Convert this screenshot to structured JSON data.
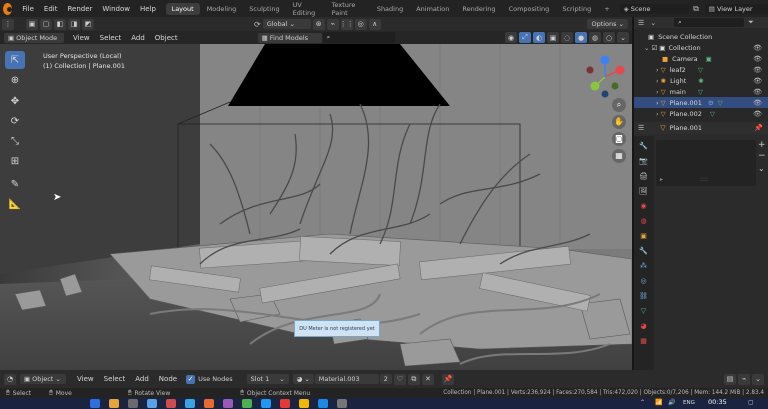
{
  "menu": {
    "items": [
      "File",
      "Edit",
      "Render",
      "Window",
      "Help"
    ]
  },
  "workspaces": {
    "tabs": [
      "Layout",
      "Modeling",
      "Sculpting",
      "UV Editing",
      "Texture Paint",
      "Shading",
      "Animation",
      "Rendering",
      "Compositing",
      "Scripting"
    ],
    "active": "Layout",
    "add_glyph": "+"
  },
  "scene": {
    "label": "Scene"
  },
  "view_layer": {
    "label": "View Layer"
  },
  "header": {
    "transform_orientation": "Global",
    "options_label": "Options",
    "mode": "Object Mode",
    "view_menu": [
      "View",
      "Select",
      "Add",
      "Object"
    ],
    "find_models_label": "Find Models"
  },
  "viewport": {
    "perspective": "User Perspective (Local)",
    "collection": "(1) Collection | Plane.001",
    "tooltip": "DU Meter is not registered yet",
    "gizmo_colors": {
      "x": "#e5484d",
      "y": "#8cc63f",
      "z": "#3b82f6"
    }
  },
  "outliner": {
    "root": "Scene Collection",
    "collection": "Collection",
    "items": [
      {
        "name": "Camera",
        "icon": "camera-icon",
        "selected": false
      },
      {
        "name": "leaf2",
        "icon": "mesh-icon",
        "selected": false
      },
      {
        "name": "Light",
        "icon": "light-icon",
        "selected": false
      },
      {
        "name": "main",
        "icon": "mesh-icon",
        "selected": false
      },
      {
        "name": "Plane.001",
        "icon": "mesh-icon",
        "selected": true
      },
      {
        "name": "Plane.002",
        "icon": "mesh-icon",
        "selected": false
      }
    ]
  },
  "properties": {
    "object_name": "Plane.001",
    "list_grip": "::::"
  },
  "shader_editor": {
    "mode": "Object",
    "menus": [
      "View",
      "Select",
      "Add",
      "Node"
    ],
    "use_nodes_label": "Use Nodes",
    "slot": "Slot 1",
    "material": "Material.003",
    "user_count": "2"
  },
  "status": {
    "left_items": [
      "Select",
      "Move",
      "Rotate View",
      "Object Context Menu"
    ],
    "stats": "Collection | Plane.001 | Verts:236,924 | Faces:270,584 | Tris:472,020 | Objects:0/7,206 | Mem: 144.2 MiB | 2.83.4"
  },
  "taskbar": {
    "time": "00:35",
    "lang": "ENG",
    "app_colors": [
      "#2f6fdb",
      "#e8a33d",
      "#6b6b6b",
      "#5aa0e6",
      "#d04b4b",
      "#3aa3e3",
      "#e86a2e",
      "#9b59b6",
      "#4caf50",
      "#2196f3",
      "#e53935",
      "#f2b705",
      "#1e88e5",
      "#757575"
    ]
  },
  "colors": {
    "accent": "#4772b3",
    "selection": "#334d80",
    "orange": "#e87d0d",
    "taskbar": "#1a2440"
  }
}
